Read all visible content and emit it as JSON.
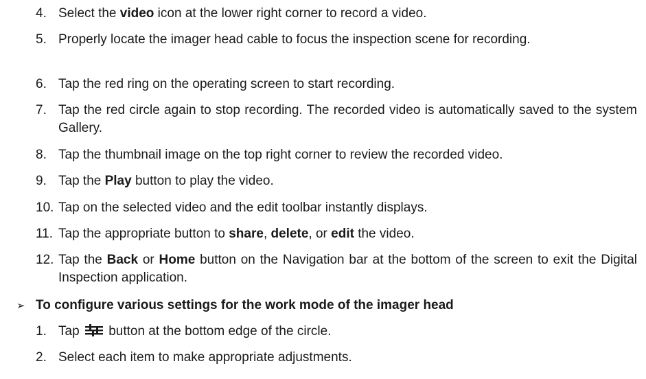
{
  "steps": [
    {
      "num": "4.",
      "parts": [
        "Select the ",
        "video",
        " icon at the lower right corner to record a video."
      ]
    },
    {
      "num": "5.",
      "text": "Properly locate the imager head cable to focus the inspection scene for recording."
    },
    {
      "num": "6.",
      "text": "Tap the red ring on the operating screen to start recording."
    },
    {
      "num": "7.",
      "text": "Tap the red circle again to stop recording. The recorded video is automatically saved to the system Gallery."
    },
    {
      "num": "8.",
      "text": "Tap the thumbnail image on the top right corner to review the recorded video."
    },
    {
      "num": "9.",
      "parts": [
        "Tap the ",
        "Play",
        " button to play the video."
      ]
    },
    {
      "num": "10.",
      "text": "Tap on the selected video and the edit toolbar instantly displays."
    },
    {
      "num": "11.",
      "parts": [
        "Tap the appropriate button to ",
        "share",
        ", ",
        "delete",
        ", or ",
        "edit",
        " the video."
      ]
    },
    {
      "num": "12.",
      "parts": [
        "Tap the ",
        "Back",
        " or ",
        "Home",
        " button on the Navigation bar at the bottom of the screen to exit the Digital Inspection application."
      ]
    }
  ],
  "section": {
    "bullet": "➢",
    "heading": "To configure various settings for the work mode of the imager head",
    "steps": [
      {
        "num": "1.",
        "before": "Tap ",
        "icon": "settings-sliders-icon",
        "after": " button at the bottom edge of the circle."
      },
      {
        "num": "2.",
        "text": "Select each item to make appropriate adjustments."
      }
    ]
  }
}
